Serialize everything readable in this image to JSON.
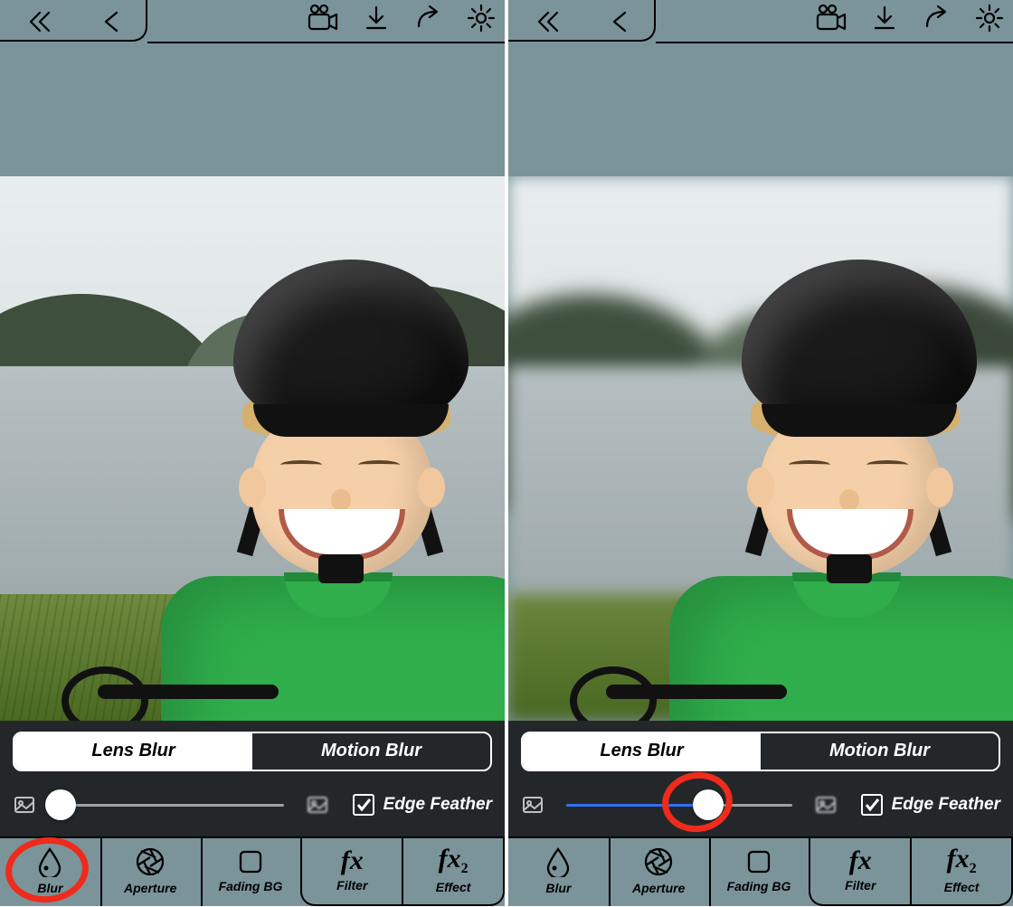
{
  "colors": {
    "chrome": "#7b949a",
    "dark": "#23272a",
    "accent": "#2e6ff2",
    "annotation": "#ef2b1c"
  },
  "panes": [
    {
      "side": "left",
      "blurred": false,
      "segmented": {
        "options": [
          "Lens Blur",
          "Motion Blur"
        ],
        "active": 0
      },
      "slider": {
        "min": 0,
        "max": 100,
        "value": 0,
        "fillColor": "#9aa2a8"
      },
      "edgeFeather": {
        "checked": true,
        "label": "Edge Feather"
      },
      "annotation_target": "mode-blur"
    },
    {
      "side": "right",
      "blurred": true,
      "segmented": {
        "options": [
          "Lens Blur",
          "Motion Blur"
        ],
        "active": 0
      },
      "slider": {
        "min": 0,
        "max": 100,
        "value": 62,
        "fillColor": "#2e6ff2"
      },
      "edgeFeather": {
        "checked": true,
        "label": "Edge Feather"
      },
      "annotation_target": "slider-thumb"
    }
  ],
  "modes": [
    {
      "id": "blur",
      "label": "Blur",
      "icon": "drop"
    },
    {
      "id": "aperture",
      "label": "Aperture",
      "icon": "aperture"
    },
    {
      "id": "fadingbg",
      "label": "Fading BG",
      "icon": "square"
    },
    {
      "id": "filter",
      "label": "Filter",
      "icon": "fx"
    },
    {
      "id": "effect",
      "label": "Effect",
      "icon": "fx2"
    }
  ],
  "topIcons": [
    "camera",
    "download",
    "share",
    "settings"
  ]
}
